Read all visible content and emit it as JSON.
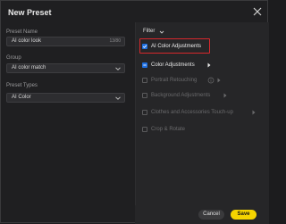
{
  "dialog": {
    "title": "New Preset",
    "close_icon": "close-icon"
  },
  "preset_name": {
    "label": "Preset Name",
    "value": "AI color look",
    "count": "13/80"
  },
  "group": {
    "label": "Group",
    "value": "AI color match"
  },
  "preset_types": {
    "label": "Preset Types",
    "value": "AI Color"
  },
  "filter": {
    "label": "Filter"
  },
  "options": [
    {
      "label": "AI Color Adjustments",
      "checked": true,
      "enabled": true,
      "has_arrow": false,
      "has_info": false
    },
    {
      "label": "Color Adjustments",
      "checked": false,
      "partial": true,
      "enabled": true,
      "has_arrow": true,
      "has_info": false
    },
    {
      "label": "Portrait Retouching",
      "checked": false,
      "enabled": false,
      "has_arrow": false,
      "has_info": true
    },
    {
      "label": "Background Adjustments",
      "checked": false,
      "enabled": false,
      "has_arrow": true,
      "has_info": false
    },
    {
      "label": "Clothes and Accessories Touch-up",
      "checked": false,
      "enabled": false,
      "has_arrow": true,
      "has_info": false
    },
    {
      "label": "Crop & Rotate",
      "checked": false,
      "enabled": false,
      "has_arrow": false,
      "has_info": false
    }
  ],
  "footer": {
    "cancel_label": "Cancel",
    "save_label": "Save"
  },
  "colors": {
    "accent": "#1f6fe0",
    "save": "#f5d400",
    "highlight": "#d7282c"
  }
}
